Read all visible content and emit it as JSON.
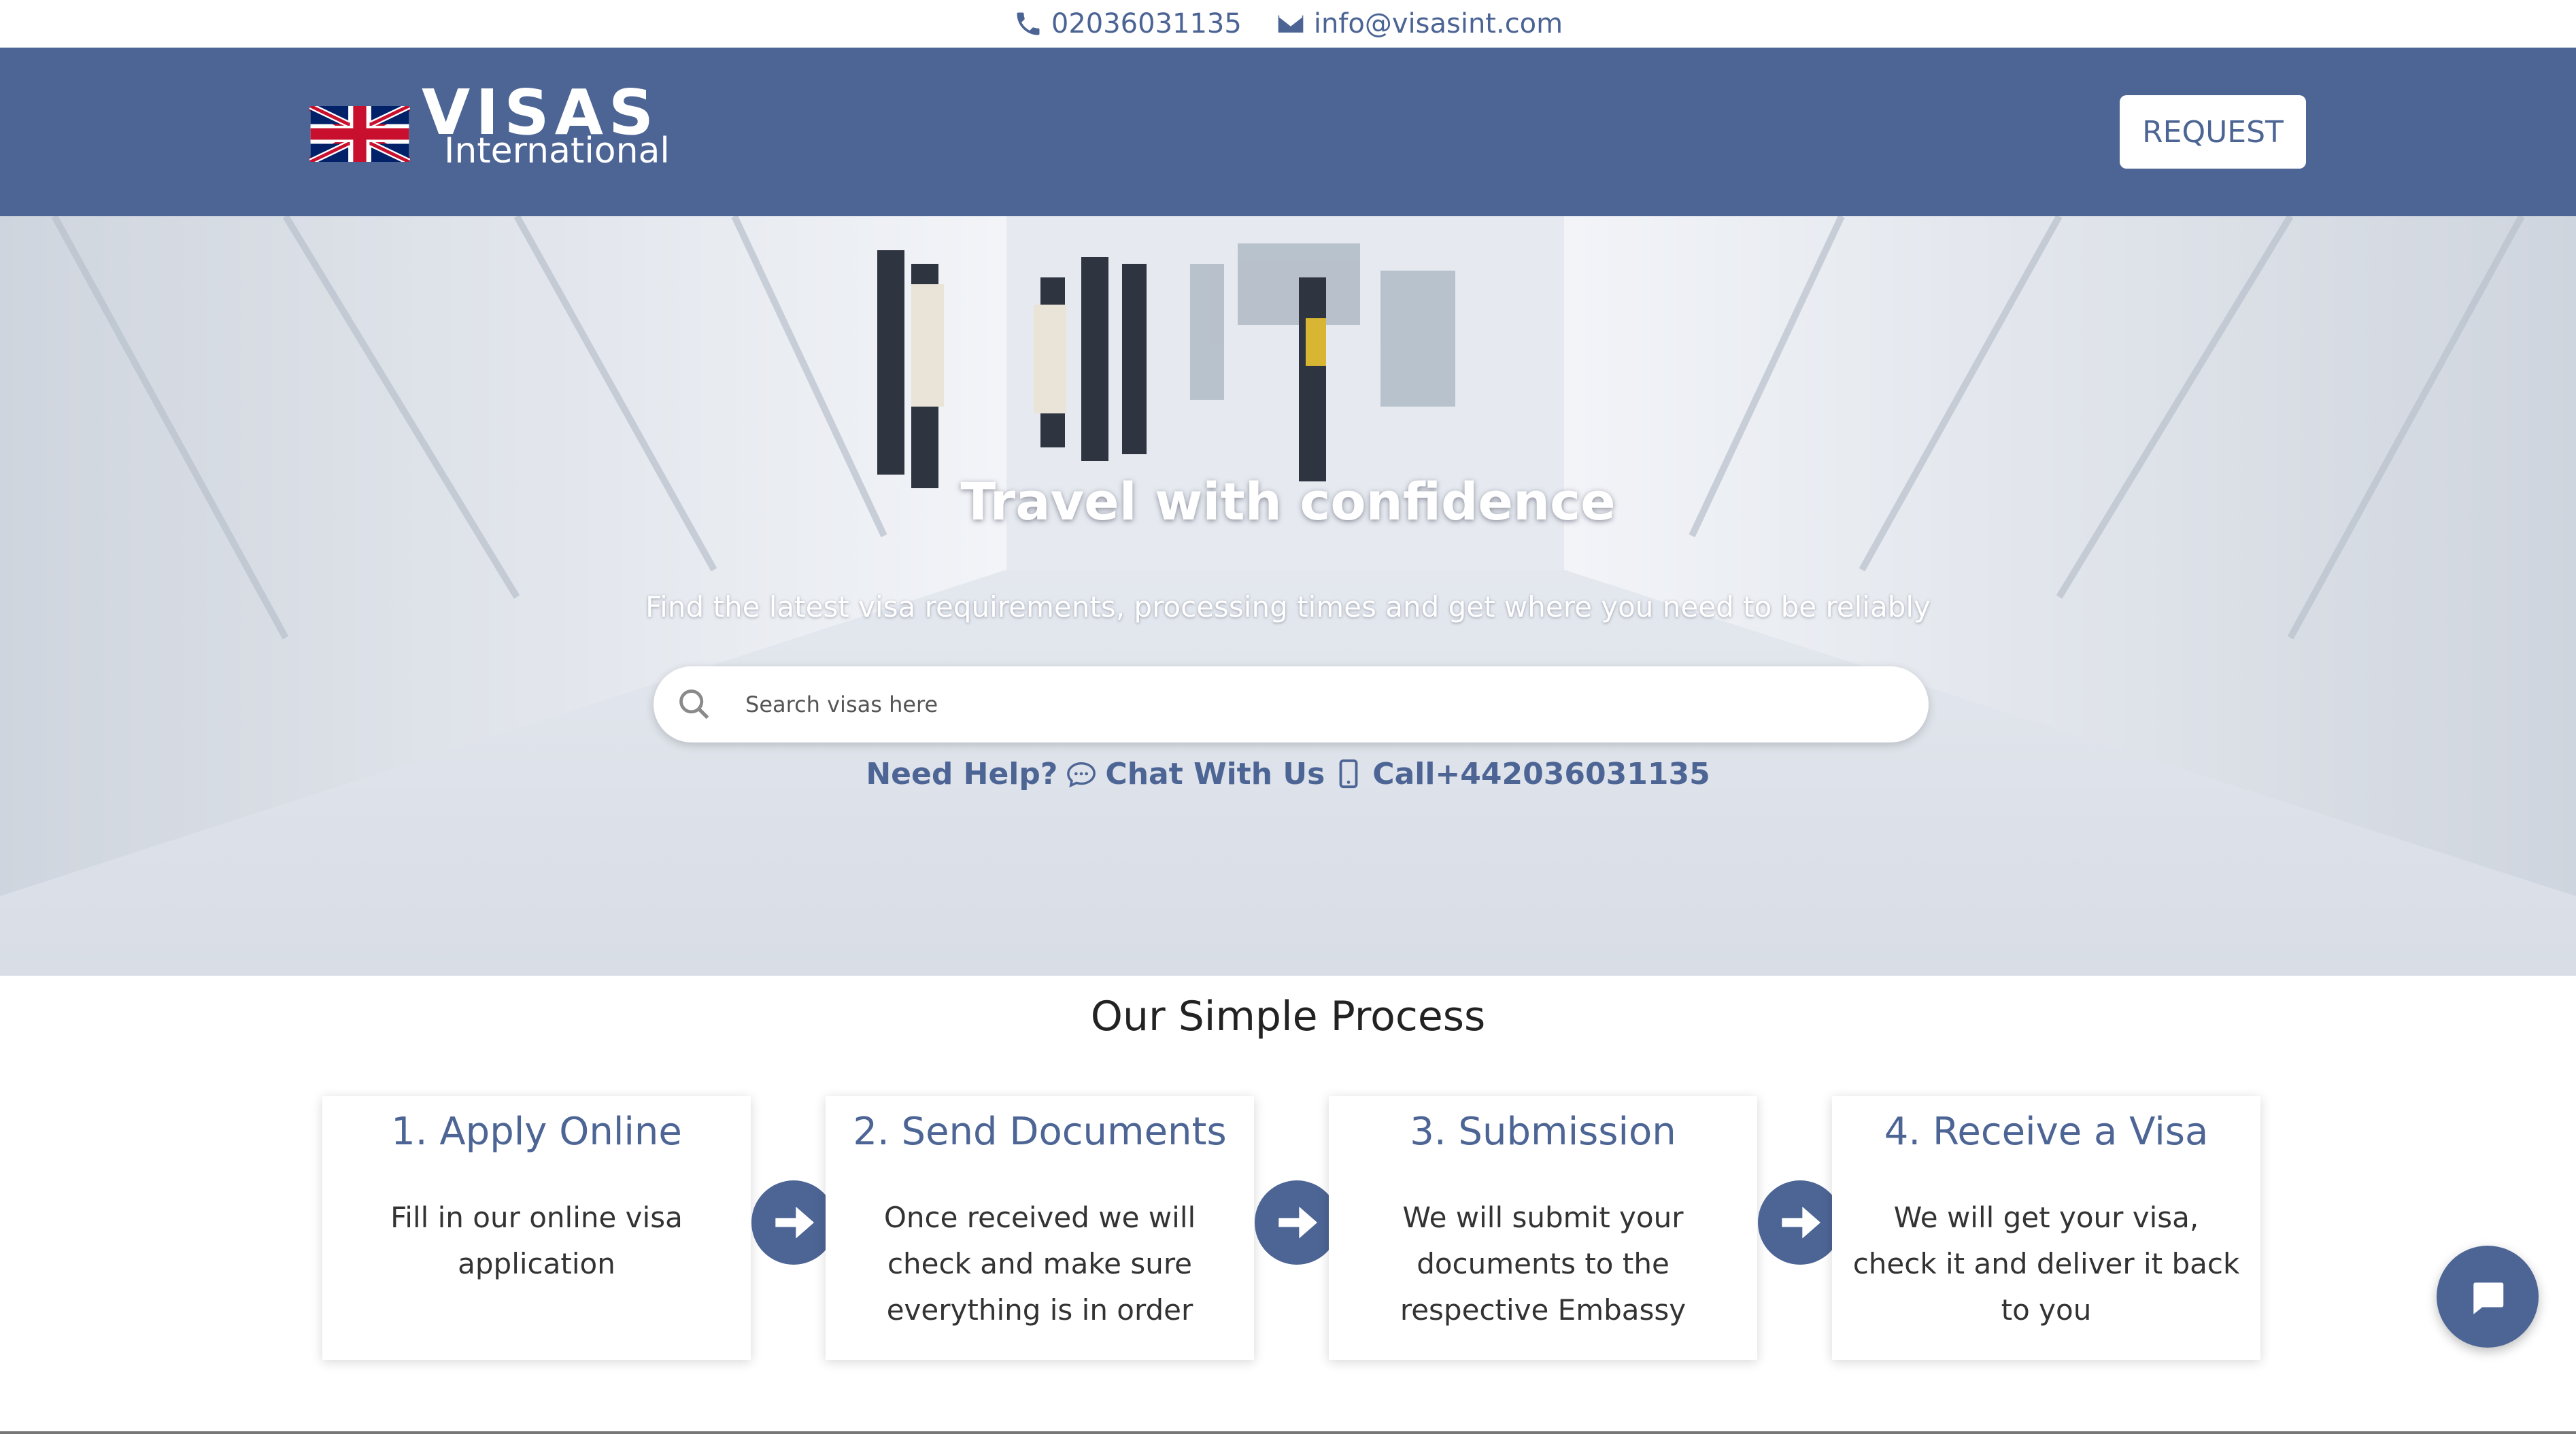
{
  "topbar": {
    "phone": "02036031135",
    "email": "info@visasint.com"
  },
  "header": {
    "logo_main": "VISAS",
    "logo_sub": "International",
    "request_label": "REQUEST"
  },
  "hero": {
    "title": "Travel with confidence",
    "subtitle": "Find the latest visa requirements, processing times and get where you need to be reliably",
    "search_placeholder": "Search visas here",
    "help_label": "Need Help?",
    "chat_label": "Chat With Us",
    "call_label": "Call+442036031135"
  },
  "process": {
    "title": "Our Simple Process",
    "steps": [
      {
        "title": "1. Apply Online",
        "text": "Fill in our online visa application"
      },
      {
        "title": "2. Send Documents",
        "text": "Once received we will check and make sure everything is in order"
      },
      {
        "title": "3. Submission",
        "text": "We will submit your documents to the respective Embassy"
      },
      {
        "title": "4. Receive a Visa",
        "text": "We will get your visa, check it and deliver it back to you"
      }
    ]
  },
  "colors": {
    "brand": "#4d6595",
    "header_bg": "#4d6595",
    "text_dark": "#333333"
  },
  "icons": {
    "phone": "phone-icon",
    "email": "envelope-icon",
    "search": "search-icon",
    "chat": "chat-icon",
    "mobile": "mobile-phone-icon",
    "arrow": "arrow-right-icon",
    "chat_widget": "chat-bubble-icon"
  }
}
